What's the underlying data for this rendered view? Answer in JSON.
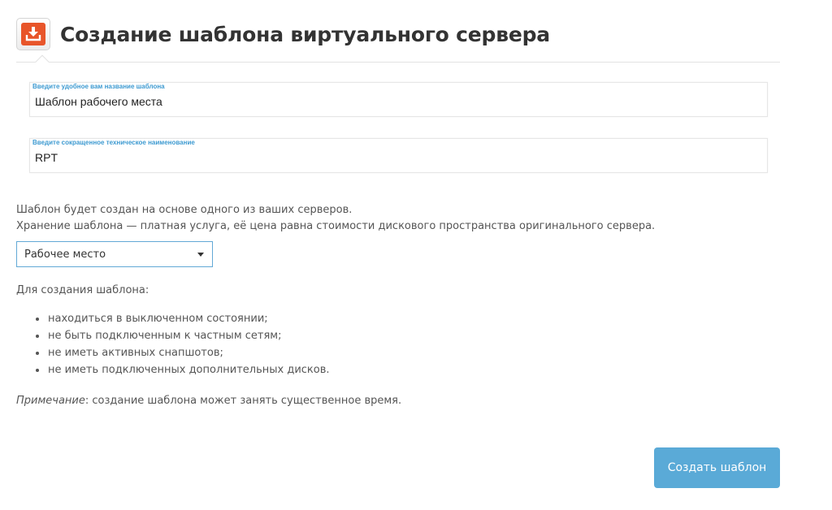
{
  "header": {
    "icon": "download-icon",
    "icon_color": "#e8552a",
    "title": "Создание шаблона виртуального сервера"
  },
  "form": {
    "name_field": {
      "label": "Введите удобное вам название шаблона",
      "value": "Шаблон рабочего места"
    },
    "code_field": {
      "label": "Введите сокращенное техническое наименование",
      "value": "RPT"
    }
  },
  "description": {
    "line1": "Шаблон будет создан на основе одного из ваших серверов.",
    "line2": "Хранение шаблона — платная услуга, её цена равна стоимости дискового пространства оригинального сервера."
  },
  "server_select": {
    "selected": "Рабочее место"
  },
  "requirements": {
    "title": "Для создания шаблона:",
    "items": [
      "находиться в выключенном состоянии;",
      "не быть подключенным к частным сетям;",
      "не иметь активных снапшотов;",
      "не иметь подключенных дополнительных дисков."
    ]
  },
  "note": {
    "label": "Примечание",
    "text": ": создание шаблона может занять существенное время."
  },
  "actions": {
    "create_label": "Создать шаблон",
    "accent_color": "#5aaad7"
  }
}
